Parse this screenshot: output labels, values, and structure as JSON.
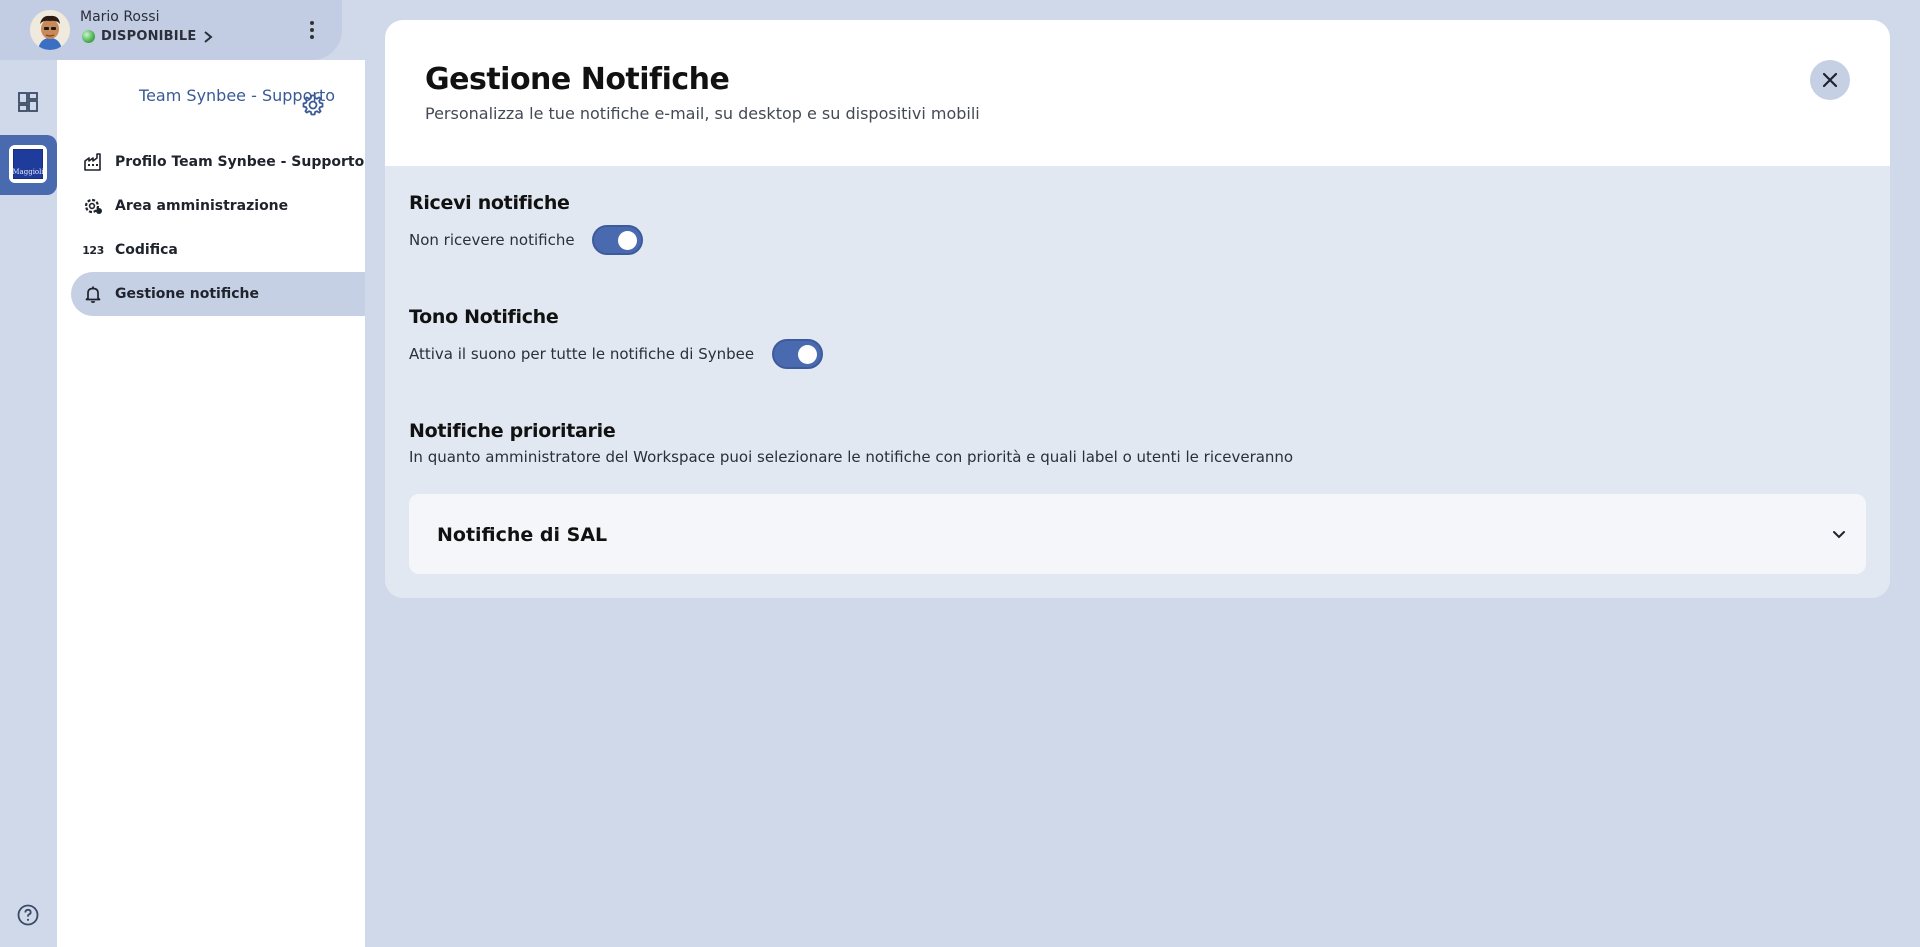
{
  "user": {
    "name": "Mario Rossi",
    "status": "DISPONIBILE"
  },
  "sidebar": {
    "team_title": "Team Synbee - Supporto",
    "workspace_logo_text": "Maggioli",
    "items": [
      {
        "label": "Profilo Team Synbee - Supporto",
        "icon": "factory-icon",
        "active": false
      },
      {
        "label": "Area amministrazione",
        "icon": "admin-gear-icon",
        "active": false
      },
      {
        "label": "Codifica",
        "icon": "numbers-123-icon",
        "icon_text": "123",
        "active": false
      },
      {
        "label": "Gestione notifiche",
        "icon": "bell-icon",
        "active": true
      }
    ]
  },
  "main": {
    "title": "Gestione Notifiche",
    "subtitle": "Personalizza le tue notifiche e-mail, su desktop e su dispositivi mobili",
    "sections": {
      "receive": {
        "title": "Ricevi notifiche",
        "label": "Non ricevere notifiche",
        "toggle_on": true
      },
      "tone": {
        "title": "Tono Notifiche",
        "label": "Attiva il suono per tutte le notifiche di Synbee",
        "toggle_on": true
      },
      "priority": {
        "title": "Notifiche prioritarie",
        "description": "In quanto amministratore del Workspace puoi selezionare le notifiche con priorità e quali label o utenti le riceveranno"
      }
    },
    "accordion": {
      "title": "Notifiche di SAL"
    }
  },
  "colors": {
    "background": "#d0d9ea",
    "accent": "#4a6ab0",
    "active_item": "#c5d0e5",
    "panel": "#e2e8f2",
    "status_green": "#4caf50"
  }
}
